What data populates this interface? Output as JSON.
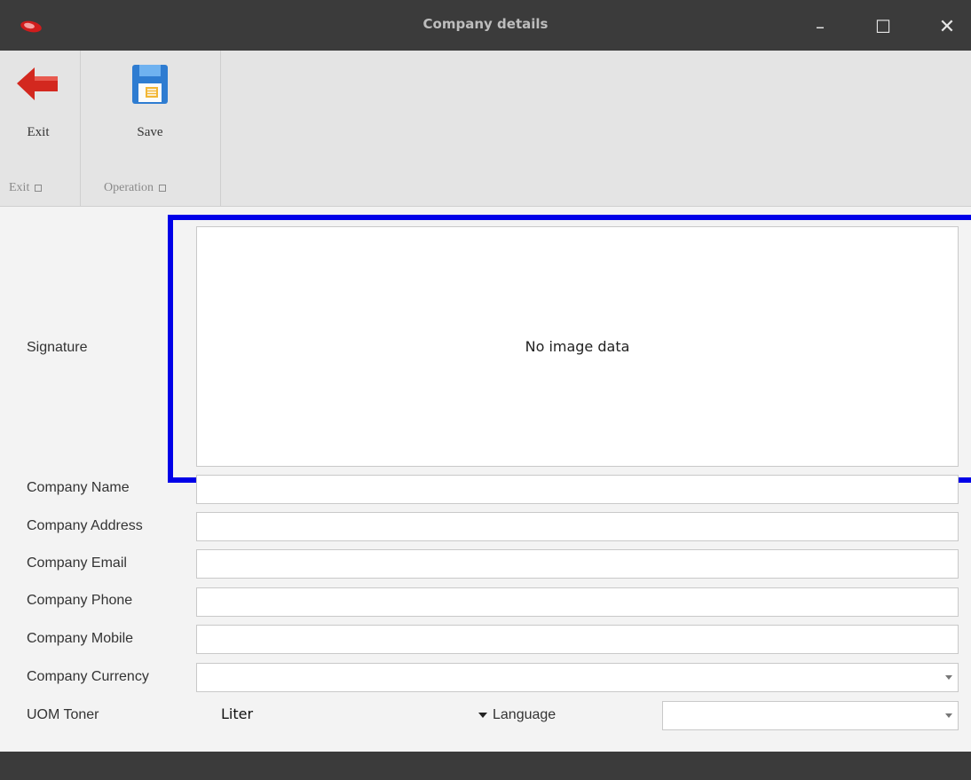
{
  "window": {
    "title": "Company details",
    "minimize_glyph": "–",
    "maximize_glyph": "☐",
    "close_glyph": "✕"
  },
  "ribbon": {
    "exit_button": "Exit",
    "save_button": "Save",
    "groups": [
      {
        "label": "Exit"
      },
      {
        "label": "Operation"
      }
    ],
    "icons": {
      "exit": "back-arrow-icon",
      "save": "floppy-disk-icon"
    }
  },
  "form": {
    "signature_label": "Signature",
    "signature_placeholder": "No image data",
    "fields": {
      "company_name": "Company Name",
      "company_address": "Company Address",
      "company_email": "Company Email",
      "company_phone": "Company Phone",
      "company_mobile": "Company Mobile",
      "company_currency": "Company Currency",
      "uom_toner": "UOM Toner",
      "language": "Language"
    },
    "values": {
      "company_name": "",
      "company_address": "",
      "company_email": "",
      "company_phone": "",
      "company_mobile": "",
      "company_currency": "",
      "uom_toner": "Liter",
      "language": ""
    }
  },
  "colors": {
    "titlebar": "#3b3b3b",
    "ribbon": "#e4e4e4",
    "highlight": "#0000e8",
    "exit_icon": "#d3281f",
    "save_icon": "#2e7cd1"
  }
}
